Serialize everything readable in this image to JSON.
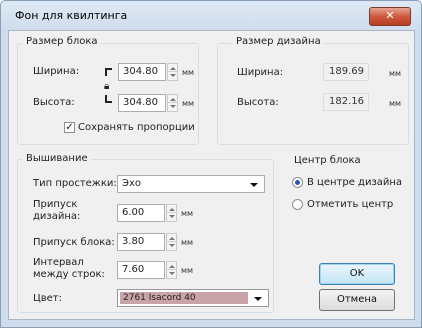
{
  "window": {
    "title": "Фон для квилтинга",
    "close_glyph": "✕"
  },
  "block_size": {
    "group_label": "Размер блока",
    "width_label": "Ширина:",
    "width_value": "304.80",
    "height_label": "Высота:",
    "height_value": "304.80",
    "unit": "мм",
    "keep_proportions_label": "Сохранять пропорции",
    "keep_proportions_checked": true
  },
  "design_size": {
    "group_label": "Размер дизайна",
    "width_label": "Ширина:",
    "width_value": "189.69",
    "height_label": "Высота:",
    "height_value": "182.16",
    "unit": "мм"
  },
  "embroidery": {
    "group_label": "Вышивание",
    "stitch_type_label": "Тип простежки:",
    "stitch_type_value": "Эхо",
    "design_allowance_label": "Припуск дизайна:",
    "design_allowance_value": "6.00",
    "block_allowance_label": "Припуск блока:",
    "block_allowance_value": "3.80",
    "line_spacing_label": "Интервал между строк:",
    "line_spacing_value": "7.60",
    "unit": "мм",
    "color_label": "Цвет:",
    "color_value": "2761 Isacord 40",
    "color_swatch": "#c8a3a8"
  },
  "block_center": {
    "group_label": "Центр блока",
    "option_design_center": "В центре дизайна",
    "option_mark_center": "Отметить центр",
    "selected": "design_center"
  },
  "buttons": {
    "ok": "OK",
    "cancel": "Отмена"
  }
}
